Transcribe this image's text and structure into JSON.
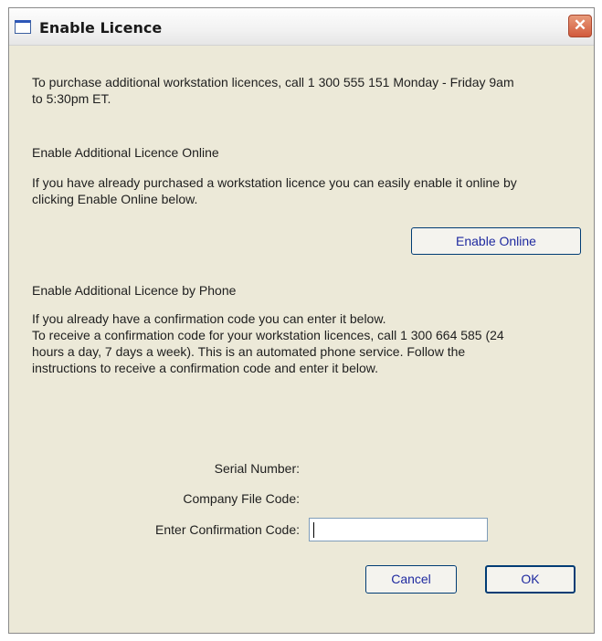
{
  "window": {
    "title": "Enable Licence",
    "close_glyph": "✕",
    "title_icon": "window-icon"
  },
  "intro": {
    "line1": "To purchase additional workstation licences, call 1 300 555 151 Monday - Friday 9am",
    "line2": "to 5:30pm ET."
  },
  "online": {
    "heading": "Enable Additional Licence Online",
    "line1": "If you have already purchased a workstation licence you can easily enable it online by",
    "line2": "clicking Enable Online below.",
    "button": "Enable Online"
  },
  "phone": {
    "heading": "Enable Additional Licence by Phone",
    "line1": "If you already have a confirmation code you can enter it below.",
    "line2": "To receive a confirmation code for your workstation licences, call 1 300 664 585 (24",
    "line3": "hours a day, 7 days a week).  This is an automated phone service.  Follow the",
    "line4": "instructions to receive a confirmation code and enter it below."
  },
  "form": {
    "serial_label": "Serial Number:",
    "company_label": "Company File Code:",
    "confirm_label": "Enter Confirmation Code:",
    "confirm_value": ""
  },
  "buttons": {
    "cancel": "Cancel",
    "ok": "OK"
  },
  "colors": {
    "window_bg": "#ece9d8",
    "button_text": "#1f2aa0",
    "close_red": "#d25a3c"
  }
}
